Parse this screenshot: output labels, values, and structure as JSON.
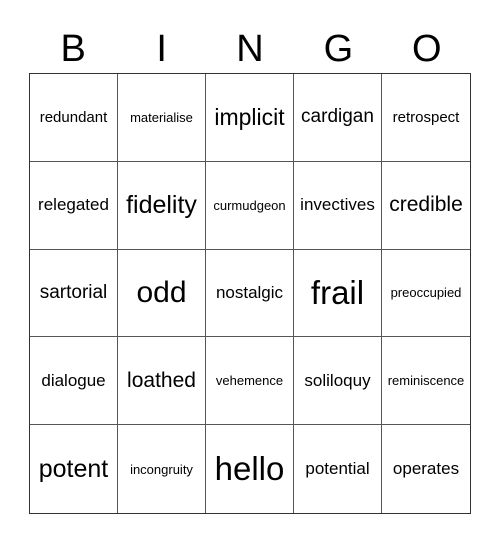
{
  "header": [
    "B",
    "I",
    "N",
    "G",
    "O"
  ],
  "cells": [
    "redundant",
    "materialise",
    "implicit",
    "cardigan",
    "retrospect",
    "relegated",
    "fidelity",
    "curmudgeon",
    "invectives",
    "credible",
    "sartorial",
    "odd",
    "nostalgic",
    "frail",
    "preoccupied",
    "dialogue",
    "loathed",
    "vehemence",
    "soliloquy",
    "reminiscence",
    "potent",
    "incongruity",
    "hello",
    "potential",
    "operates"
  ]
}
